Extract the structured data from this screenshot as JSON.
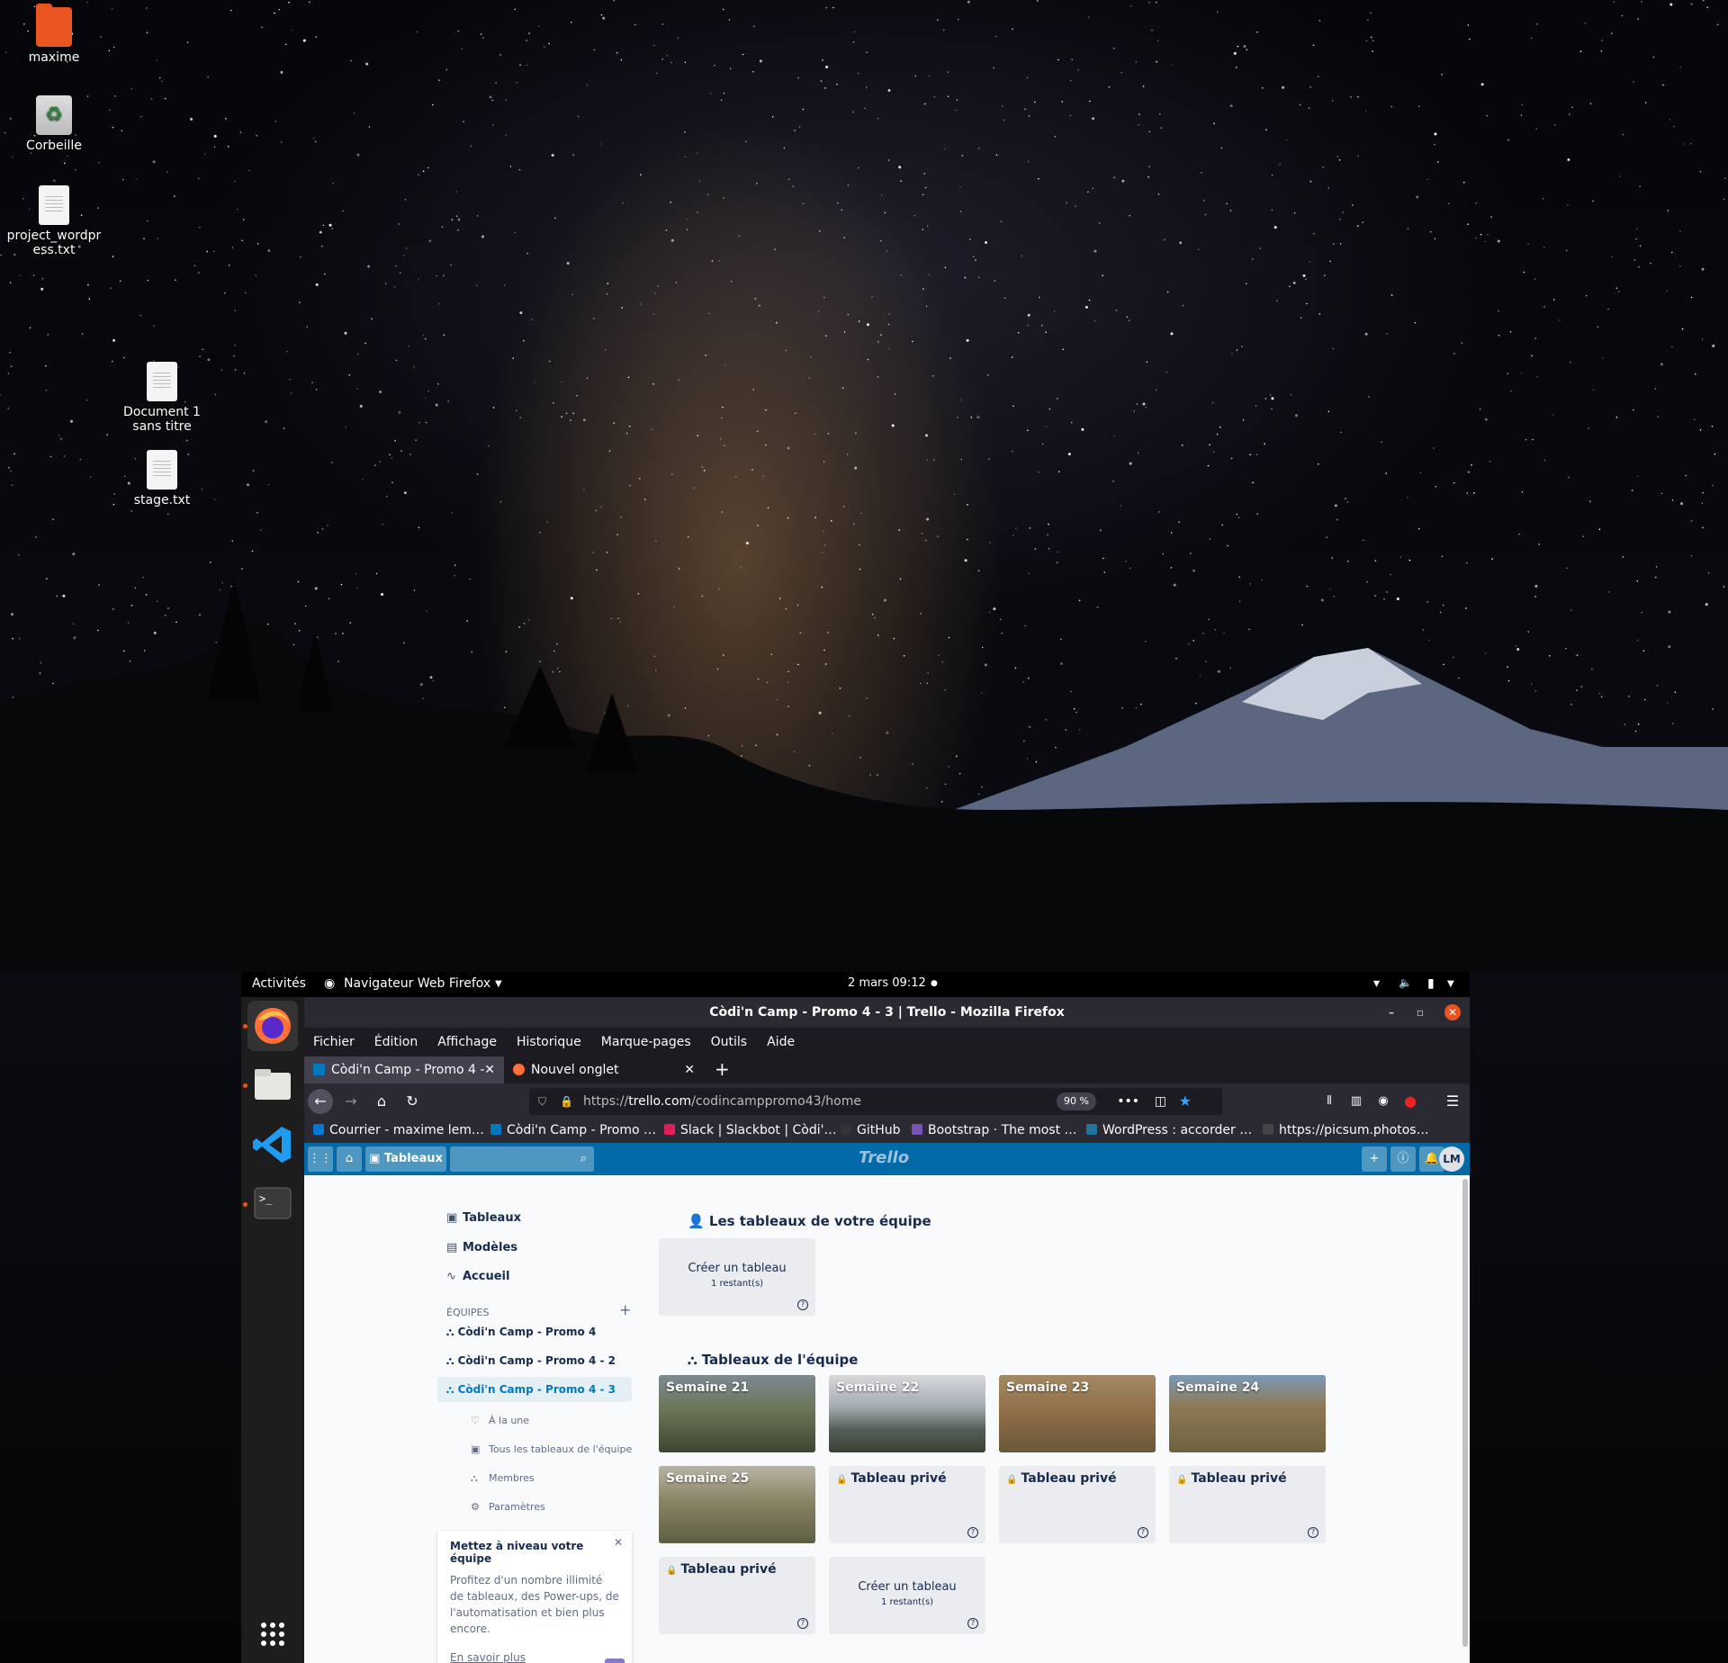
{
  "desktop": {
    "icons": [
      {
        "label": "maxime"
      },
      {
        "label": "Corbeille"
      },
      {
        "label": "project_wordpress.txt"
      },
      {
        "label": "Document 1 sans titre"
      },
      {
        "label": "stage.txt"
      }
    ]
  },
  "gnome": {
    "activities": "Activités",
    "app_menu": "Navigateur Web Firefox",
    "clock": "2 mars  09:12"
  },
  "window": {
    "title": "Còdi'n Camp - Promo 4 - 3 | Trello - Mozilla Firefox"
  },
  "menu": [
    "Fichier",
    "Édition",
    "Affichage",
    "Historique",
    "Marque-pages",
    "Outils",
    "Aide"
  ],
  "tabs": [
    {
      "label": "Còdi'n Camp - Promo 4 -"
    },
    {
      "label": "Nouvel onglet"
    }
  ],
  "url": {
    "prefix": "https://",
    "host": "trello.com",
    "path": "/codincamppromo43/home",
    "zoom": "90 %"
  },
  "bookmarks": [
    {
      "label": "Courrier - maxime lem…",
      "color": "#0078d4"
    },
    {
      "label": "Còdi'n Camp - Promo …",
      "color": "#0079bf"
    },
    {
      "label": "Slack | Slackbot | Còdi'…",
      "color": "#e01e5a"
    },
    {
      "label": "GitHub",
      "color": "#333333"
    },
    {
      "label": "Bootstrap · The most …",
      "color": "#7952b3"
    },
    {
      "label": "WordPress : accorder …",
      "color": "#21759b"
    },
    {
      "label": "https://picsum.photos…",
      "color": "#444444"
    }
  ],
  "trello": {
    "boards_btn": "Tableaux",
    "logo": "Trello",
    "avatar": "LM",
    "sidebar": {
      "links": [
        "Tableaux",
        "Modèles",
        "Accueil"
      ],
      "teams_heading": "ÉQUIPES",
      "teams": [
        "Còdi'n Camp - Promo 4",
        "Còdi'n Camp - Promo 4 - 2",
        "Còdi'n Camp - Promo 4 - 3"
      ],
      "sub": [
        "À la une",
        "Tous les tableaux de l'équipe",
        "Membres",
        "Paramètres"
      ],
      "upgrade": {
        "title": "Mettez à niveau votre équipe",
        "body": "Profitez d'un nombre illimité de tableaux, des Power-ups, de l'automatisation et bien plus encore.",
        "link": "En savoir plus"
      }
    },
    "your_boards_title": "Les tableaux de votre équipe",
    "team_boards_title": "Tableaux de l'équipe",
    "create_board": "Créer un tableau",
    "remaining": "1 restant(s)",
    "boards": [
      "Semaine 21",
      "Semaine 22",
      "Semaine 23",
      "Semaine 24",
      "Semaine 25"
    ],
    "private": "Tableau privé"
  }
}
